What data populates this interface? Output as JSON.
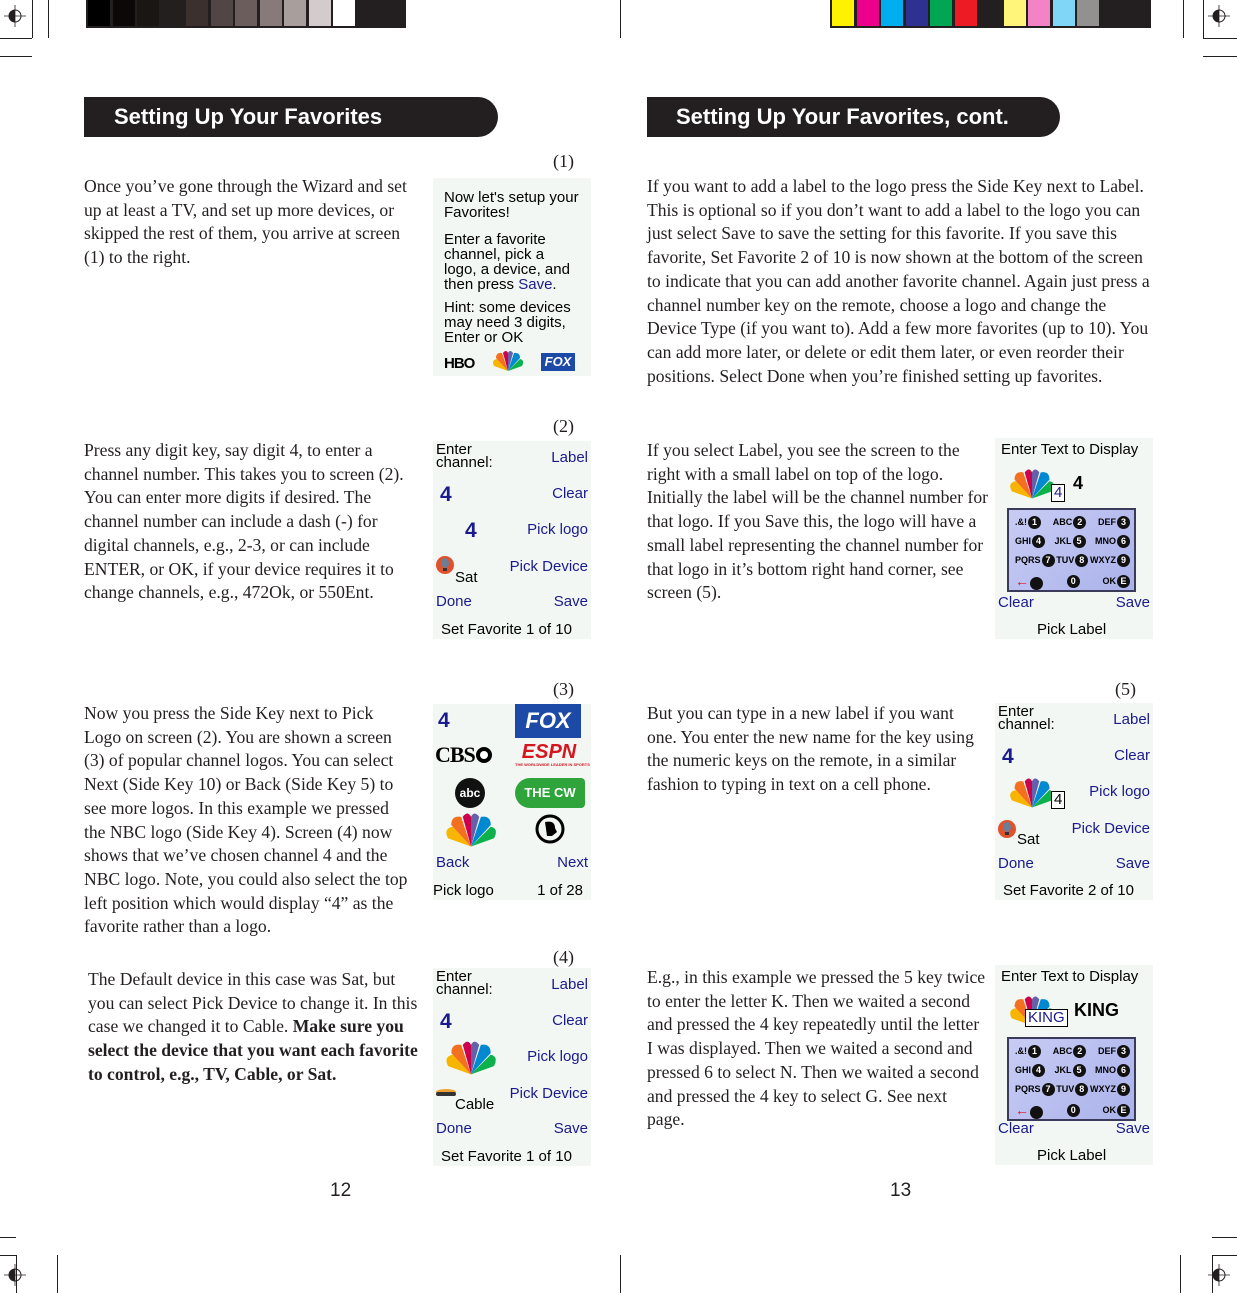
{
  "print_marks": {
    "grayscale_swatches": [
      "#000000",
      "#0b0807",
      "#1a1614",
      "#231f1e",
      "#3b302e",
      "#514645",
      "#6a5d5b",
      "#877a78",
      "#a89e9c",
      "#d4cccc",
      "#ffffff"
    ],
    "color_swatches": [
      "#fff200",
      "#ec008c",
      "#00aeef",
      "#2e3192",
      "#00a651",
      "#ed1c24",
      "#231f20",
      "#fff57a",
      "#f482c7",
      "#7fd6f7",
      "#939090"
    ]
  },
  "left_page": {
    "header": "Setting Up Your Favorites",
    "page_number": "12",
    "sections": [
      {
        "screen_label": "(1)",
        "text": "Once you’ve gone through the Wizard and set up at least a TV, and set up more devices, or skipped the rest of them, you arrive at screen (1) to the right."
      },
      {
        "screen_label": "(2)",
        "text": "Press any digit key, say digit 4, to enter a channel number. This takes you to screen (2). You can enter more digits if desired. The channel number can include a dash (-) for digital channels, e.g., 2-3, or can include ENTER, or OK, if your device requires it to change channels, e.g., 472Ok, or 550Ent."
      },
      {
        "screen_label": "(3)",
        "text": "Now you press the Side Key next to Pick Logo on screen (2). You are shown a screen (3) of popular channel logos. You can select Next (Side Key 10) or Back (Side Key 5) to see more logos. In this example we pressed the NBC logo (Side Key 4). Screen (4) now shows that we’ve chosen channel 4 and the NBC logo. Note, you could also select the top left position which would display “4” as the favorite rather than a logo."
      },
      {
        "screen_label": "(4)",
        "text_plain": "The Default device in this case was Sat, but you can select Pick Device to change it. In this case we changed it to Cable. ",
        "text_bold": "Make sure you select the device that you want each favorite to control, e.g., TV, Cable, or Sat."
      }
    ],
    "screen1": {
      "line1": "Now let's setup your",
      "line2": "Favorites!",
      "line3": "Enter a favorite",
      "line4": "channel, pick a",
      "line5": "logo, a device, and",
      "line6_pre": "then press ",
      "line6_save": "Save",
      "line6_post": ".",
      "hint1": "Hint: some devices",
      "hint2": "may need 3 digits,",
      "hint3": "Enter or OK",
      "logos": [
        "HBO",
        "NBC",
        "FOX"
      ]
    },
    "screen2": {
      "enter1": "Enter",
      "enter2": "channel:",
      "channel": "4",
      "logo_text": "4",
      "device": "Sat",
      "label": "Label",
      "clear": "Clear",
      "pick_logo": "Pick logo",
      "pick_device": "Pick Device",
      "done": "Done",
      "save": "Save",
      "status": "Set Favorite 1 of 10"
    },
    "screen3": {
      "top_left": "4",
      "logos": [
        "FOX",
        "CBS",
        "ESPN",
        "abc",
        "THE CW",
        "NBC",
        "PBS"
      ],
      "espn_tagline": "THE WORLDWIDE LEADER IN SPORTS",
      "back": "Back",
      "next": "Next",
      "title": "Pick logo",
      "page": "1 of 28"
    },
    "screen4": {
      "enter1": "Enter",
      "enter2": "channel:",
      "channel": "4",
      "device": "Cable",
      "label": "Label",
      "clear": "Clear",
      "pick_logo": "Pick logo",
      "pick_device": "Pick Device",
      "done": "Done",
      "save": "Save",
      "status": "Set Favorite 1 of 10"
    }
  },
  "right_page": {
    "header": "Setting Up Your Favorites, cont.",
    "page_number": "13",
    "para1": "If you want to add a label to the logo press the Side Key next to Label. This is optional so if you don’t want to add a label to the logo you can just select Save to save the setting for this favorite. If you save this favorite, Set Favorite 2 of 10 is now shown at the bottom of the screen to indicate that you can add another favorite channel. Again just press a channel number key on the remote, choose a logo and change the Device Type (if you want to). Add a few more favorites (up to 10). You can add more later, or delete or edit them later, or even reorder their positions. Select Done when you’re finished setting up favorites.",
    "para2": "If you select Label, you see the screen to the right with a small label on top of the logo. Initially the label will be the channel number for that logo. If you Save this, the logo will have a small label representing the channel number for that logo in it’s bottom right hand corner, see screen (5).",
    "screen5_label": "(5)",
    "para3": "But you can type in a new label if you want one. You enter the new name for the key using the numeric keys on the remote, in a similar fashion to typing in text on a cell phone.",
    "para4": "E.g., in this example we pressed the 5 key twice to enter the letter K. Then we waited a second and pressed the 4 key repeatedly until the letter I was displayed. Then we waited a second and pressed 6 to select N. Then we waited a second and pressed the 4 key to select G. See next page.",
    "label_screen_a": {
      "title": "Enter Text to Display",
      "label_box": "4",
      "label_text": "4",
      "keypad_rows": [
        [
          ".&!",
          "1",
          "ABC",
          "2",
          "DEF",
          "3"
        ],
        [
          "GHI",
          "4",
          "JKL",
          "5",
          "MNO",
          "6"
        ],
        [
          "PQRS",
          "7",
          "TUV",
          "8",
          "WXYZ",
          "9"
        ],
        [
          "←",
          "",
          "",
          "0",
          "OK",
          "E"
        ]
      ],
      "clear": "Clear",
      "save": "Save",
      "footer": "Pick Label"
    },
    "screen5": {
      "enter1": "Enter",
      "enter2": "channel:",
      "channel": "4",
      "label_box": "4",
      "device": "Sat",
      "label": "Label",
      "clear": "Clear",
      "pick_logo": "Pick logo",
      "pick_device": "Pick Device",
      "done": "Done",
      "save": "Save",
      "status": "Set Favorite 2 of 10"
    },
    "label_screen_b": {
      "title": "Enter Text to Display",
      "label_box": "KING",
      "label_text": "KING",
      "clear": "Clear",
      "save": "Save",
      "footer": "Pick Label"
    }
  }
}
